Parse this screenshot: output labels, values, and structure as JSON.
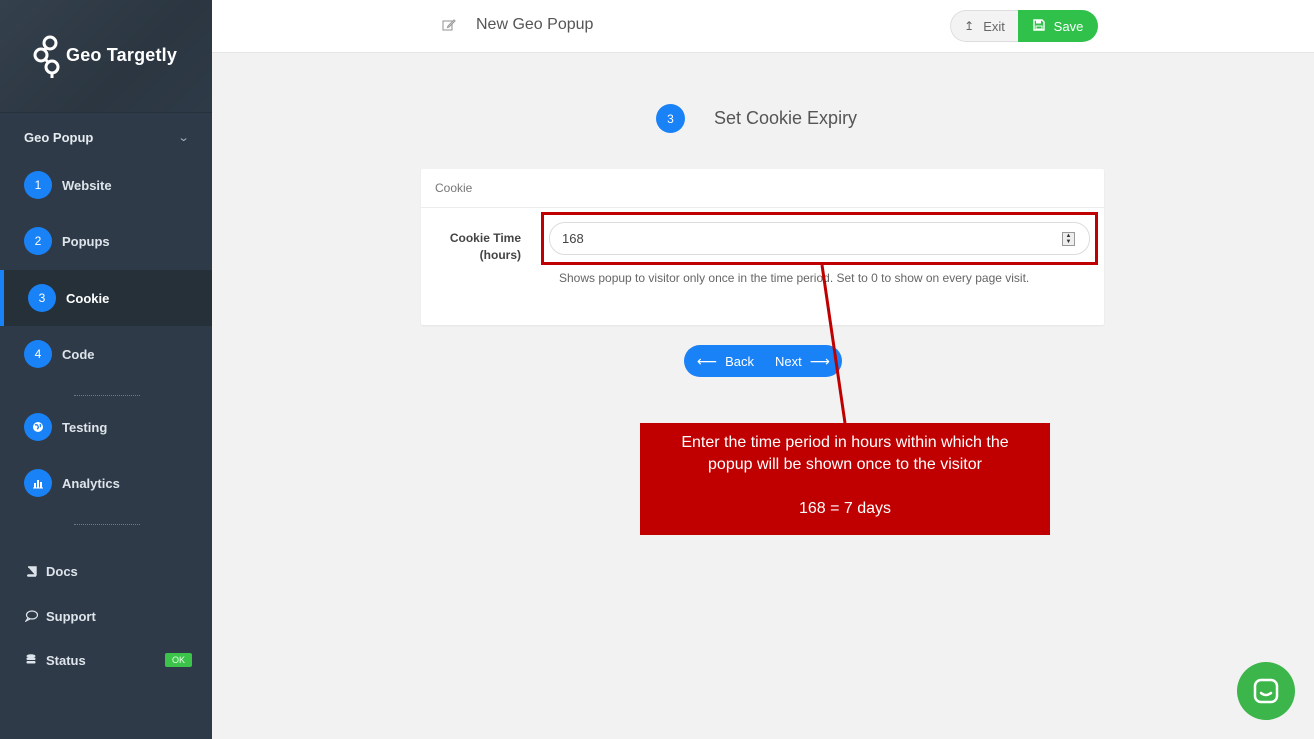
{
  "app": {
    "brand": "Geo Targetly"
  },
  "sidebar": {
    "section_label": "Geo Popup",
    "steps": [
      {
        "number": "1",
        "label": "Website"
      },
      {
        "number": "2",
        "label": "Popups"
      },
      {
        "number": "3",
        "label": "Cookie"
      },
      {
        "number": "4",
        "label": "Code"
      }
    ],
    "tools": [
      {
        "label": "Testing",
        "icon": "globe-icon"
      },
      {
        "label": "Analytics",
        "icon": "chart-icon"
      }
    ],
    "footer": [
      {
        "label": "Docs",
        "icon": "book-icon"
      },
      {
        "label": "Support",
        "icon": "chat-bubble-icon"
      },
      {
        "label": "Status",
        "icon": "database-icon",
        "badge": "OK"
      }
    ],
    "active_step": "Cookie"
  },
  "header": {
    "title": "New Geo Popup",
    "exit_label": "Exit",
    "save_label": "Save"
  },
  "step": {
    "number": "3",
    "title": "Set Cookie Expiry"
  },
  "card": {
    "heading": "Cookie",
    "field_label_line1": "Cookie Time",
    "field_label_line2": "(hours)",
    "field_value": "168",
    "help_text": "Shows popup to visitor only once in the time period. Set to 0 to show on every page visit."
  },
  "nav": {
    "back_label": "Back",
    "next_label": "Next"
  },
  "callout": {
    "line1": "Enter the time period in hours within which the",
    "line2": "popup will be shown once to the visitor",
    "line3": "168 = 7 days"
  },
  "colors": {
    "sidebar_bg": "#2e3a47",
    "accent_blue": "#1a82f7",
    "save_green": "#2fc14a",
    "callout_red": "#c00000",
    "chat_green": "#3cb54a"
  }
}
